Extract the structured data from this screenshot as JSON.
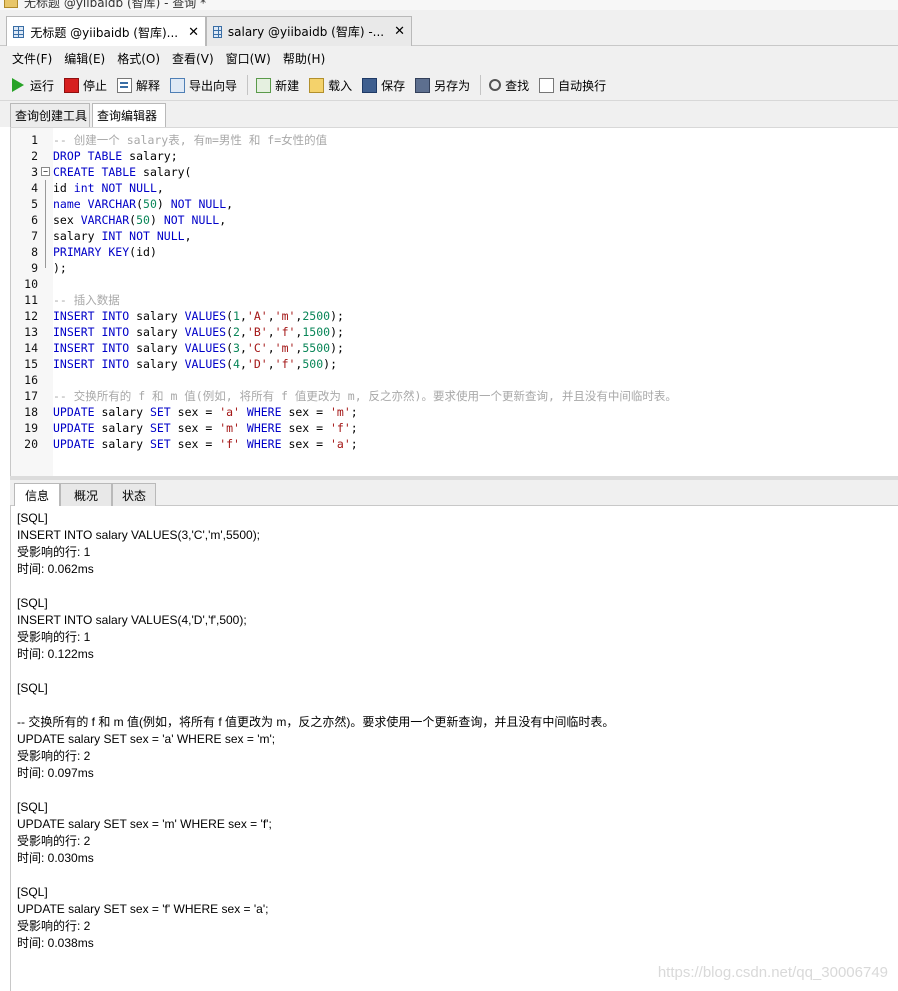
{
  "window": {
    "title": "无标题 @yiibaidb (智库) - 查询 *"
  },
  "doc_tabs": [
    {
      "label": "无标题 @yiibaidb (智库)...",
      "close": "✕"
    },
    {
      "label": "salary @yiibaidb (智库) -...",
      "close": "✕"
    }
  ],
  "menu": [
    "文件(F)",
    "编辑(E)",
    "格式(O)",
    "查看(V)",
    "窗口(W)",
    "帮助(H)"
  ],
  "toolbar": {
    "run": "运行",
    "stop": "停止",
    "explain": "解释",
    "export": "导出向导",
    "new": "新建",
    "load": "载入",
    "save": "保存",
    "save_as": "另存为",
    "find": "查找",
    "word_wrap": "自动换行"
  },
  "sub_tabs": [
    "查询创建工具",
    "查询编辑器"
  ],
  "editor": {
    "lines": [
      {
        "n": "1",
        "tokens": [
          [
            "-- 创建一个 salary表, 有m=男性 和 f=女性的值",
            "cm"
          ]
        ]
      },
      {
        "n": "2",
        "tokens": [
          [
            "DROP TABLE",
            "kw"
          ],
          [
            " salary;",
            ""
          ]
        ]
      },
      {
        "n": "3",
        "tokens": [
          [
            "CREATE TABLE",
            "kw"
          ],
          [
            " salary(",
            ""
          ]
        ]
      },
      {
        "n": "4",
        "tokens": [
          [
            "id ",
            ""
          ],
          [
            "int NOT NULL",
            "kw"
          ],
          [
            ",",
            ""
          ]
        ]
      },
      {
        "n": "5",
        "tokens": [
          [
            "name VARCHAR",
            "kw"
          ],
          [
            "(",
            ""
          ],
          [
            "50",
            "num"
          ],
          [
            ") ",
            ""
          ],
          [
            "NOT NULL",
            "kw"
          ],
          [
            ",",
            ""
          ]
        ]
      },
      {
        "n": "6",
        "tokens": [
          [
            "sex ",
            ""
          ],
          [
            "VARCHAR",
            "kw"
          ],
          [
            "(",
            ""
          ],
          [
            "50",
            "num"
          ],
          [
            ") ",
            ""
          ],
          [
            "NOT NULL",
            "kw"
          ],
          [
            ",",
            ""
          ]
        ]
      },
      {
        "n": "7",
        "tokens": [
          [
            "salary ",
            ""
          ],
          [
            "INT NOT NULL",
            "kw"
          ],
          [
            ",",
            ""
          ]
        ]
      },
      {
        "n": "8",
        "tokens": [
          [
            "PRIMARY KEY",
            "kw"
          ],
          [
            "(id)",
            ""
          ]
        ]
      },
      {
        "n": "9",
        "tokens": [
          [
            ");",
            ""
          ]
        ]
      },
      {
        "n": "10",
        "tokens": []
      },
      {
        "n": "11",
        "tokens": [
          [
            "-- 插入数据",
            "cm"
          ]
        ]
      },
      {
        "n": "12",
        "tokens": [
          [
            "INSERT INTO",
            "kw"
          ],
          [
            " salary ",
            ""
          ],
          [
            "VALUES",
            "kw"
          ],
          [
            "(",
            ""
          ],
          [
            "1",
            "num"
          ],
          [
            ",",
            ""
          ],
          [
            "'A'",
            "str"
          ],
          [
            ",",
            ""
          ],
          [
            "'m'",
            "str"
          ],
          [
            ",",
            ""
          ],
          [
            "2500",
            "num"
          ],
          [
            ");",
            ""
          ]
        ]
      },
      {
        "n": "13",
        "tokens": [
          [
            "INSERT INTO",
            "kw"
          ],
          [
            " salary ",
            ""
          ],
          [
            "VALUES",
            "kw"
          ],
          [
            "(",
            ""
          ],
          [
            "2",
            "num"
          ],
          [
            ",",
            ""
          ],
          [
            "'B'",
            "str"
          ],
          [
            ",",
            ""
          ],
          [
            "'f'",
            "str"
          ],
          [
            ",",
            ""
          ],
          [
            "1500",
            "num"
          ],
          [
            ");",
            ""
          ]
        ]
      },
      {
        "n": "14",
        "tokens": [
          [
            "INSERT INTO",
            "kw"
          ],
          [
            " salary ",
            ""
          ],
          [
            "VALUES",
            "kw"
          ],
          [
            "(",
            ""
          ],
          [
            "3",
            "num"
          ],
          [
            ",",
            ""
          ],
          [
            "'C'",
            "str"
          ],
          [
            ",",
            ""
          ],
          [
            "'m'",
            "str"
          ],
          [
            ",",
            ""
          ],
          [
            "5500",
            "num"
          ],
          [
            ");",
            ""
          ]
        ]
      },
      {
        "n": "15",
        "tokens": [
          [
            "INSERT INTO",
            "kw"
          ],
          [
            " salary ",
            ""
          ],
          [
            "VALUES",
            "kw"
          ],
          [
            "(",
            ""
          ],
          [
            "4",
            "num"
          ],
          [
            ",",
            ""
          ],
          [
            "'D'",
            "str"
          ],
          [
            ",",
            ""
          ],
          [
            "'f'",
            "str"
          ],
          [
            ",",
            ""
          ],
          [
            "500",
            "num"
          ],
          [
            ");",
            ""
          ]
        ]
      },
      {
        "n": "16",
        "tokens": []
      },
      {
        "n": "17",
        "tokens": [
          [
            "-- 交换所有的 f 和 m 值(例如, 将所有 f 值更改为 m, 反之亦然)。要求使用一个更新查询, 并且没有中间临时表。",
            "cm"
          ]
        ]
      },
      {
        "n": "18",
        "tokens": [
          [
            "UPDATE",
            "kw"
          ],
          [
            " salary ",
            ""
          ],
          [
            "SET",
            "kw"
          ],
          [
            " sex = ",
            ""
          ],
          [
            "'a'",
            "str"
          ],
          [
            " ",
            ""
          ],
          [
            "WHERE",
            "kw"
          ],
          [
            " sex = ",
            ""
          ],
          [
            "'m'",
            "str"
          ],
          [
            ";",
            ""
          ]
        ]
      },
      {
        "n": "19",
        "tokens": [
          [
            "UPDATE",
            "kw"
          ],
          [
            " salary ",
            ""
          ],
          [
            "SET",
            "kw"
          ],
          [
            " sex = ",
            ""
          ],
          [
            "'m'",
            "str"
          ],
          [
            " ",
            ""
          ],
          [
            "WHERE",
            "kw"
          ],
          [
            " sex = ",
            ""
          ],
          [
            "'f'",
            "str"
          ],
          [
            ";",
            ""
          ]
        ]
      },
      {
        "n": "20",
        "tokens": [
          [
            "UPDATE",
            "kw"
          ],
          [
            " salary ",
            ""
          ],
          [
            "SET",
            "kw"
          ],
          [
            " sex = ",
            ""
          ],
          [
            "'f'",
            "str"
          ],
          [
            " ",
            ""
          ],
          [
            "WHERE",
            "kw"
          ],
          [
            " sex = ",
            ""
          ],
          [
            "'a'",
            "str"
          ],
          [
            ";",
            ""
          ]
        ]
      }
    ]
  },
  "result_tabs": [
    "信息",
    "概况",
    "状态"
  ],
  "info_lines": [
    "[SQL]",
    "INSERT INTO salary VALUES(3,'C','m',5500);",
    "受影响的行: 1",
    "时间: 0.062ms",
    "",
    "[SQL]",
    "INSERT INTO salary VALUES(4,'D','f',500);",
    "受影响的行: 1",
    "时间: 0.122ms",
    "",
    "[SQL]",
    "",
    "-- 交换所有的 f 和 m 值(例如，将所有 f 值更改为 m，反之亦然)。要求使用一个更新查询，并且没有中间临时表。",
    "UPDATE salary SET sex = 'a' WHERE sex = 'm';",
    "受影响的行: 2",
    "时间: 0.097ms",
    "",
    "[SQL]",
    "UPDATE salary SET sex = 'm' WHERE sex = 'f';",
    "受影响的行: 2",
    "时间: 0.030ms",
    "",
    "[SQL]",
    "UPDATE salary SET sex = 'f' WHERE sex = 'a';",
    "受影响的行: 2",
    "时间: 0.038ms"
  ],
  "watermark": "https://blog.csdn.net/qq_30006749"
}
